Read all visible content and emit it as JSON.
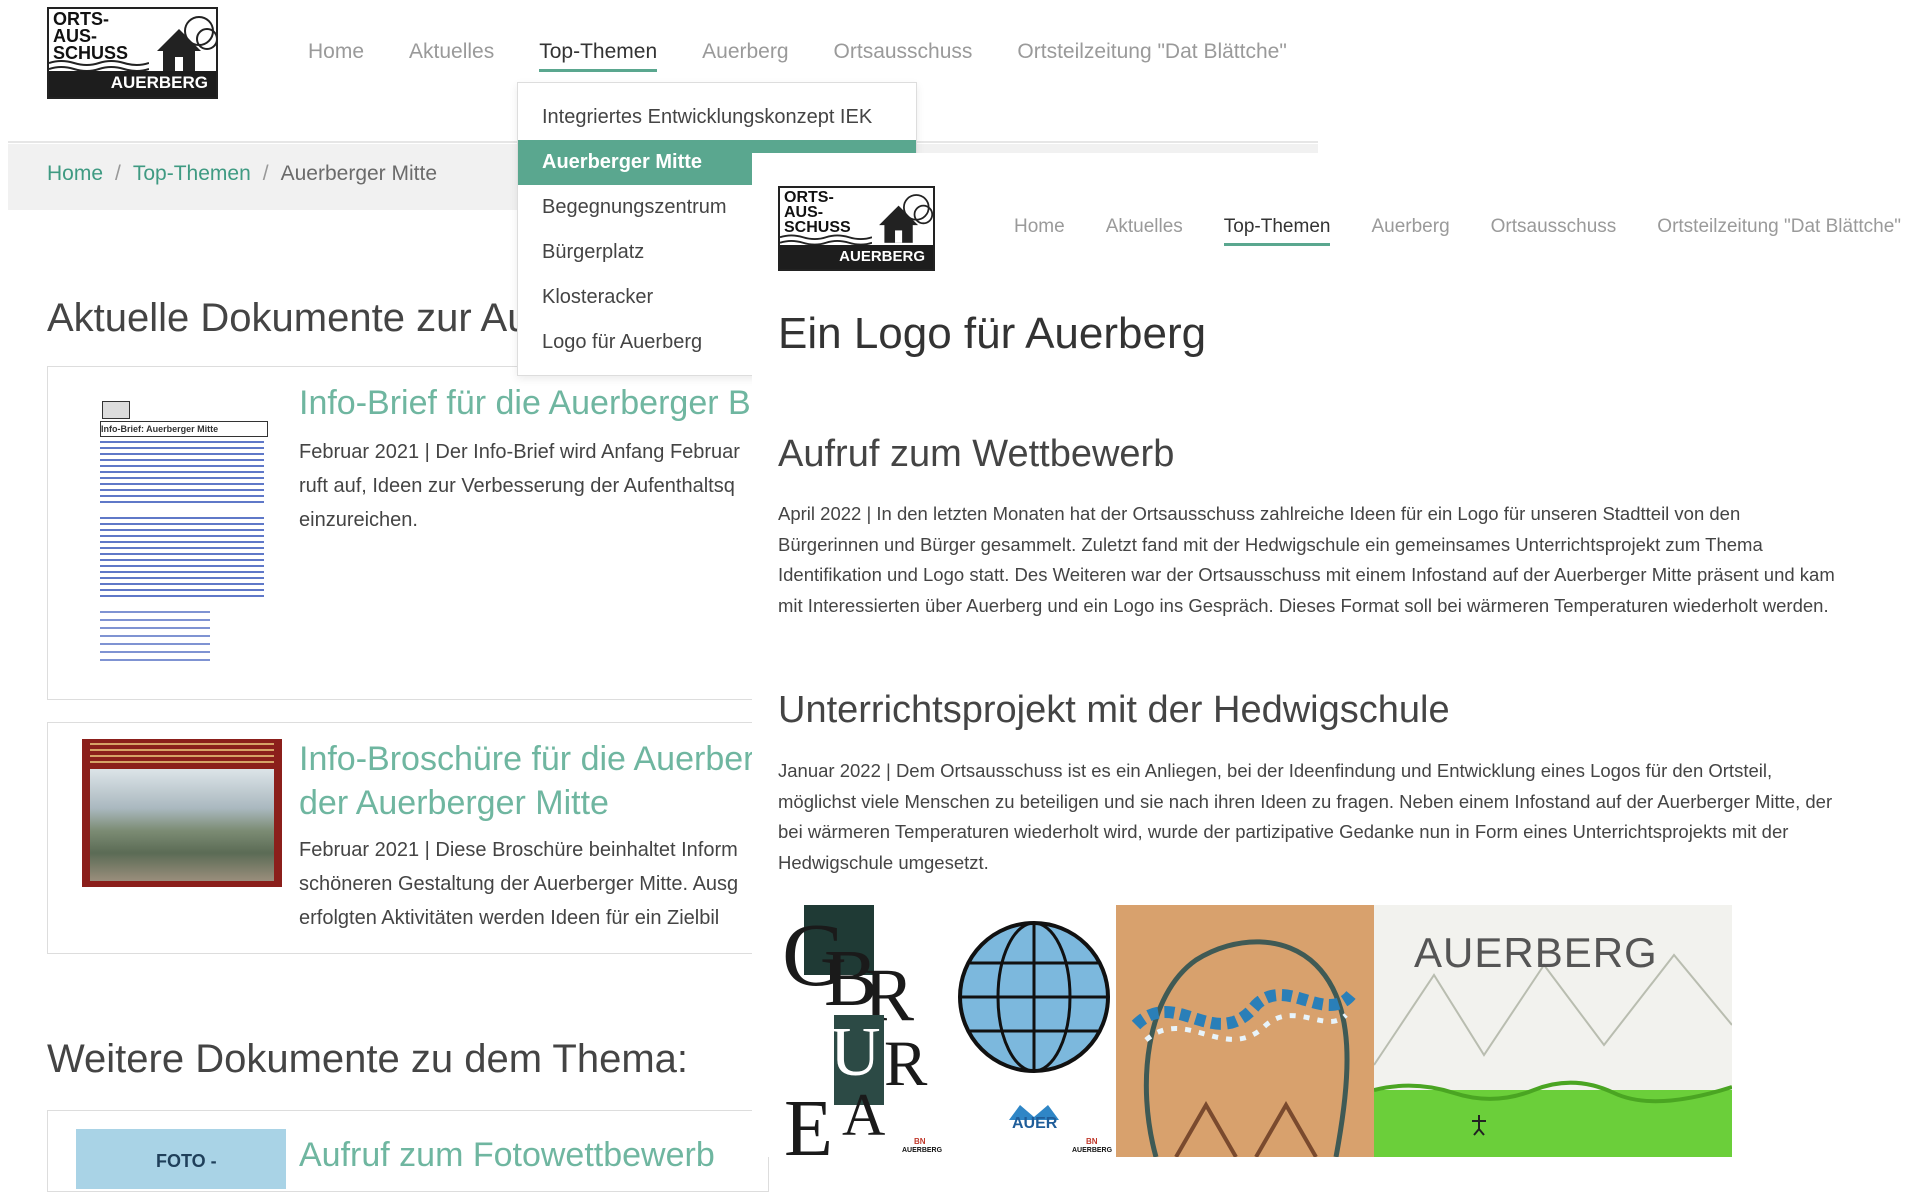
{
  "back_page": {
    "logo": {
      "lines": "ORTS-\nAUS-\nSCHUSS",
      "band": "AUERBERG"
    },
    "nav": [
      "Home",
      "Aktuelles",
      "Top-Themen",
      "Auerberg",
      "Ortsausschuss",
      "Ortsteilzeitung \"Dat Blättche\""
    ],
    "nav_active": "Top-Themen",
    "breadcrumb": {
      "home": "Home",
      "section": "Top-Themen",
      "current": "Auerberger Mitte",
      "sep": "/"
    },
    "dropdown": [
      "Integriertes Entwicklungskonzept IEK",
      "Auerberger Mitte",
      "Begegnungszentrum",
      "Bürgerplatz",
      "Klosteracker",
      "Logo für Auerberg"
    ],
    "dropdown_selected": "Auerberger Mitte",
    "section_title": "Aktuelle Dokumente zur Au",
    "card1": {
      "title": "Info-Brief für die Auerberger Bü",
      "lines": [
        "Februar 2021 | Der Info-Brief wird Anfang Februar",
        "ruft auf, Ideen zur Verbesserung der Aufenthaltsq",
        "einzureichen."
      ],
      "thumb_heading": "Info-Brief: Auerberger Mitte"
    },
    "card2": {
      "title_lines": [
        "Info-Broschüre für die Auerberg",
        "der Auerberger Mitte"
      ],
      "lines": [
        "Februar 2021 | Diese Broschüre beinhaltet Inform",
        "schöneren Gestaltung der Auerberger Mitte. Ausg",
        "erfolgten Aktivitäten werden Ideen für ein Zielbil"
      ]
    },
    "section2_title": "Weitere Dokumente zu dem Thema:",
    "card3": {
      "thumb_label": "FOTO -",
      "title": "Aufruf zum Fotowettbewerb"
    }
  },
  "front_page": {
    "logo": {
      "lines": "ORTS-\nAUS-\nSCHUSS",
      "band": "AUERBERG"
    },
    "nav": [
      "Home",
      "Aktuelles",
      "Top-Themen",
      "Auerberg",
      "Ortsausschuss",
      "Ortsteilzeitung \"Dat Blättche\""
    ],
    "nav_active": "Top-Themen",
    "title": "Ein Logo für Auerberg",
    "sections": [
      {
        "heading": "Aufruf zum Wettbewerb",
        "text": "April 2022 | In den letzten Monaten hat der Ortsausschuss zahlreiche Ideen für ein Logo für unseren Stadtteil von den Bürgerinnen und Bürger gesammelt. Zuletzt fand mit der Hedwigschule ein gemeinsames Unterrichtsprojekt zum Thema Identifikation und Logo statt. Des Weiteren war der Ortsausschuss  mit einem Infostand auf der Auerberger Mitte präsent und kam mit Interessierten über Auerberg und ein Logo ins Gespräch. Dieses Format soll bei wärmeren Temperaturen wiederholt werden."
      },
      {
        "heading": "Unterrichtsprojekt mit der Hedwigschule",
        "text": "Januar 2022 | Dem Ortsausschuss ist es ein Anliegen, bei der Ideenfindung und Entwicklung eines Logos für den Ortsteil, möglichst viele Menschen zu beteiligen und sie nach ihren Ideen zu fragen. Neben einem Infostand auf der Auerberger Mitte, der bei wärmeren Temperaturen wiederholt wird, wurde der partizipative Gedanke nun in Form eines Unterrichtsprojekts mit der Hedwigschule umgesetzt."
      }
    ],
    "gallery": {
      "globe_label": "AUER",
      "drawing_text": "AUERBERG",
      "bn_mark": "BN",
      "bn_sub": "AUERBERG"
    }
  },
  "colors": {
    "accent": "#5aa78f",
    "link": "#3f9a82",
    "card_title": "#6fb6a0",
    "nav_inactive": "#9a9a9a"
  }
}
